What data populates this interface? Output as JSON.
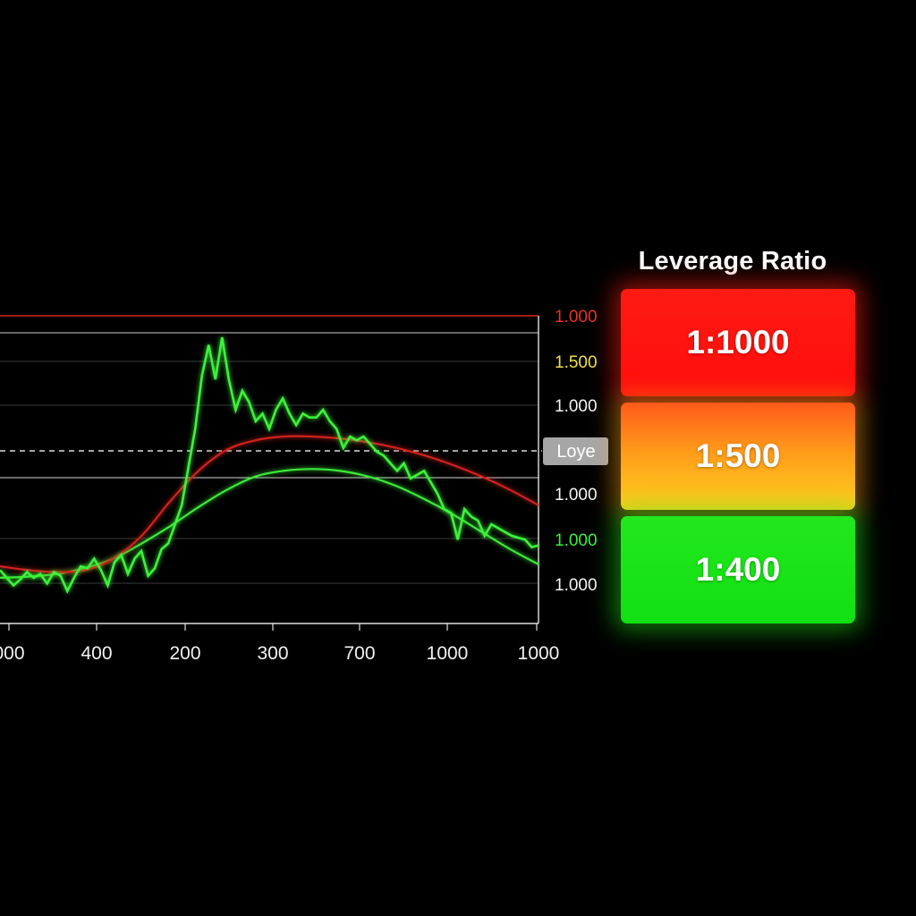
{
  "chart_data": {
    "type": "line",
    "x_ticks": [
      "000",
      "400",
      "200",
      "300",
      "700",
      "1000",
      "1000"
    ],
    "y_ticks": [
      {
        "label": "1.000",
        "color": "#e8322a"
      },
      {
        "label": "1.500",
        "color": "#f2e04a"
      },
      {
        "label": "1.000",
        "color": "#f4f4f4"
      },
      {
        "label": "1.000",
        "color": "#f4f4f4"
      },
      {
        "label": "1.000",
        "color": "#3ef03a"
      },
      {
        "label": "1.000",
        "color": "#f4f4f4"
      }
    ],
    "marker_label": "Loye",
    "grid": true,
    "series": [
      {
        "color": "#3ef23a",
        "style": "jagged",
        "values": [
          0.5,
          0.3,
          0.1,
          0.25,
          0.45,
          0.3,
          0.4,
          0.15,
          0.45,
          0.35,
          -0.05,
          0.3,
          0.6,
          0.55,
          0.8,
          0.5,
          0.1,
          0.7,
          0.9,
          0.4,
          0.8,
          1.0,
          0.35,
          0.55,
          1.05,
          1.2,
          1.7,
          2.2,
          3.2,
          4.2,
          5.6,
          6.4,
          5.5,
          6.6,
          5.5,
          4.7,
          5.2,
          4.9,
          4.4,
          4.6,
          4.2,
          4.7,
          5.0,
          4.6,
          4.3,
          4.6,
          4.5,
          4.5,
          4.7,
          4.4,
          4.2,
          3.7,
          4.0,
          3.9,
          4.0,
          3.8,
          3.6,
          3.5,
          3.3,
          3.1,
          3.3,
          2.9,
          3.0,
          3.1,
          2.8,
          2.5,
          2.1,
          2.0,
          1.3,
          2.1,
          1.9,
          1.8,
          1.4,
          1.7,
          1.6,
          1.5,
          1.4,
          1.35,
          1.3,
          1.1,
          1.15
        ]
      },
      {
        "color": "#3ee83a",
        "style": "smooth",
        "values": [
          0.3,
          0.33,
          0.4,
          0.55,
          0.8,
          1.2,
          1.65,
          2.15,
          2.6,
          2.95,
          3.1,
          3.15,
          3.1,
          2.95,
          2.7,
          2.35,
          1.95,
          1.5,
          1.05,
          0.65
        ]
      },
      {
        "color": "#d0211c",
        "style": "smooth",
        "values": [
          0.6,
          0.5,
          0.45,
          0.5,
          0.8,
          1.4,
          2.3,
          3.1,
          3.65,
          3.9,
          4.0,
          4.0,
          3.95,
          3.85,
          3.7,
          3.5,
          3.25,
          2.95,
          2.6,
          2.2
        ]
      }
    ]
  },
  "panel": {
    "title": "Leverage Ratio",
    "ratios": [
      {
        "label": "1:1000",
        "color": "#ff1a12"
      },
      {
        "label": "1:500",
        "color": "#ff9a1a"
      },
      {
        "label": "1:400",
        "color": "#14e014"
      }
    ]
  }
}
